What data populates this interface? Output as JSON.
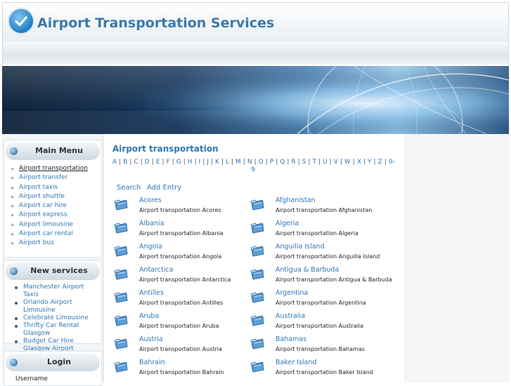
{
  "header": {
    "title": "Airport Transportation Services"
  },
  "sidebar": {
    "main_menu": {
      "title": "Main Menu",
      "items": [
        {
          "label": "Airport transportation",
          "active": true
        },
        {
          "label": "Airport transfer"
        },
        {
          "label": "Airport taxis"
        },
        {
          "label": "Airport shuttle"
        },
        {
          "label": "Airport car hire"
        },
        {
          "label": "Airport express"
        },
        {
          "label": "Airport limousine"
        },
        {
          "label": "Airport car rental"
        },
        {
          "label": "Airport bus"
        }
      ]
    },
    "new_services": {
      "title": "New services",
      "items": [
        "Manchester Airport Taxis",
        "Orlando Airport Limousine",
        "Celebrate Limousine",
        "Thrifty Car Rental Glasgow",
        "Budget Car Hire Glasgow Airport"
      ]
    },
    "login": {
      "title": "Login",
      "username_label": "Username"
    }
  },
  "main": {
    "heading": "Airport transportation",
    "letters": [
      "A",
      "B",
      "C",
      "D",
      "E",
      "F",
      "G",
      "H",
      "I",
      "J",
      "K",
      "L",
      "M",
      "N",
      "O",
      "P",
      "Q",
      "R",
      "S",
      "T",
      "U",
      "V",
      "W",
      "X",
      "Y",
      "Z",
      "0-9"
    ],
    "search_label": "Search",
    "add_label": "Add Entry",
    "entries": [
      {
        "name": "Acores",
        "desc": "Airport transportation Acores"
      },
      {
        "name": "Afghanistan",
        "desc": "Airport transportation Afghanistan"
      },
      {
        "name": "Albania",
        "desc": "Airport transportation Albania"
      },
      {
        "name": "Algeria",
        "desc": "Airport transportation Algeria"
      },
      {
        "name": "Angola",
        "desc": "Airport transportation Angola"
      },
      {
        "name": "Anguilla Island",
        "desc": "Airport transportation Anguilla Island"
      },
      {
        "name": "Antarctica",
        "desc": "Airport transportation Antarctica"
      },
      {
        "name": "Antigua & Barbuda",
        "desc": "Airport transportation Antigua & Barbuda"
      },
      {
        "name": "Antilles",
        "desc": "Airport transportation Antilles"
      },
      {
        "name": "Argentina",
        "desc": "Airport transportation Argentina"
      },
      {
        "name": "Aruba",
        "desc": "Airport transportation Aruba"
      },
      {
        "name": "Australia",
        "desc": "Airport transportation Australia"
      },
      {
        "name": "Austria",
        "desc": "Airport transportation Austria"
      },
      {
        "name": "Bahamas",
        "desc": "Airport transportation Bahamas"
      },
      {
        "name": "Bahrain",
        "desc": "Airport transportation Bahrain"
      },
      {
        "name": "Baker Island",
        "desc": "Airport transportation Baker Island"
      }
    ]
  },
  "colors": {
    "link": "#2f76b6",
    "title": "#3a79ae",
    "sidebar_bg": "#f2f5f7"
  },
  "icons": {
    "logo": "check-circle-icon",
    "entry": "folder-icon",
    "menu_bullet": "double-chevron-icon"
  }
}
